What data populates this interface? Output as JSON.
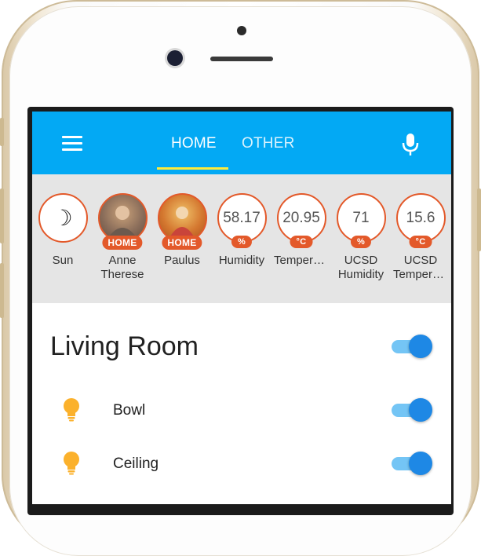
{
  "app": {
    "tabs": [
      {
        "label": "HOME",
        "active": true
      },
      {
        "label": "OTHER",
        "active": false
      }
    ],
    "accent_color": "#03a9f4",
    "indicator_color": "#ffeb3b",
    "badge_color": "#e3592a"
  },
  "badges": [
    {
      "label": "Sun",
      "value": "",
      "icon": "moon-icon",
      "tag": ""
    },
    {
      "label": "Anne Therese",
      "value": "",
      "icon": "person-photo",
      "tag": "HOME"
    },
    {
      "label": "Paulus",
      "value": "",
      "icon": "person-photo",
      "tag": "HOME"
    },
    {
      "label": "Humidity",
      "value": "58.17",
      "icon": "",
      "tag": "%"
    },
    {
      "label": "Temperat…",
      "value": "20.95",
      "icon": "",
      "tag": "°C"
    },
    {
      "label": "UCSD Humidity",
      "value": "71",
      "icon": "",
      "tag": "%"
    },
    {
      "label": "UCSD Temperat…",
      "value": "15.6",
      "icon": "",
      "tag": "°C"
    }
  ],
  "group": {
    "title": "Living Room",
    "toggle_on": true,
    "entities": [
      {
        "name": "Bowl",
        "icon": "lightbulb-icon",
        "on": true
      },
      {
        "name": "Ceiling",
        "icon": "lightbulb-icon",
        "on": true
      }
    ]
  }
}
